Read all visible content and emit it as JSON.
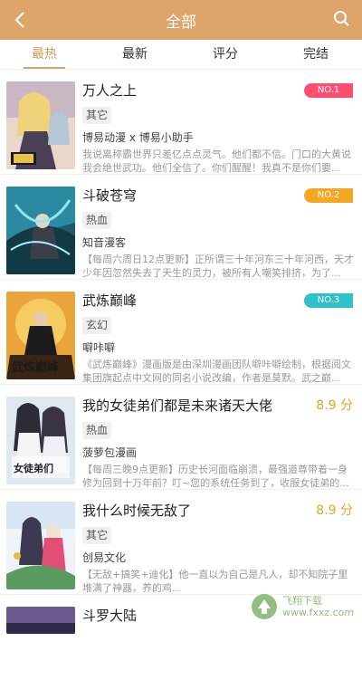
{
  "header": {
    "title": "全部",
    "back_icon": "back-arrow-icon",
    "search_icon": "search-icon"
  },
  "tabs": [
    {
      "label": "最热",
      "active": true
    },
    {
      "label": "最新",
      "active": false
    },
    {
      "label": "评分",
      "active": false
    },
    {
      "label": "完结",
      "active": false
    }
  ],
  "items": [
    {
      "name": "万人之上",
      "tag": "其它",
      "author": "博易动漫 x 博易小助手",
      "desc": "我说离称霸世界只差亿点点灵气。他们都不信。门口的大黄说我会绝世武功。他们全信了。你们醒醒！我真不是你们要...",
      "rank": "NO.1",
      "rank_color": "#ff4e6f"
    },
    {
      "name": "斗破苍穹",
      "tag": "热血",
      "author": "知音漫客",
      "desc": "【每周六周日12点更新】正所谓三十年河东三十年河西，天才少年因忽然失去了天生的灵力，被所有人嘲笑排挤，为了...",
      "rank": "NO.2",
      "rank_color": "#f5a623"
    },
    {
      "name": "武炼巅峰",
      "tag": "玄幻",
      "author": "噼咔噼",
      "desc": "《武炼巅峰》漫画版是由深圳漫画团队噼咔噼绘制，根据阅文集团旗起点中文网的同名小说改编，作者是莫默。武之巅...",
      "rank": "NO.3",
      "rank_color": "#2ec1c8"
    },
    {
      "name": "我的女徒弟们都是未来诸天大佬",
      "tag": "热血",
      "author": "菠萝包漫画",
      "desc": "【每周三晚9点更新】历史长河面临崩溃，最强道尊带着一身修为回到十万年前？叮~您的系统任务到了，收服女徒弟的...",
      "score": "8.9 分"
    },
    {
      "name": "我什么时候无敌了",
      "tag": "其它",
      "author": "创易文化",
      "desc": "【无敌+搞笑+迪化】他一直以为自己是凡人，却不知院子里堆满了神器，养的鸡...",
      "score": "8.9 分"
    },
    {
      "name": "斗罗大陆"
    }
  ],
  "watermark": {
    "line1": "飞翔下载",
    "line2": "www.fxxz.com"
  }
}
